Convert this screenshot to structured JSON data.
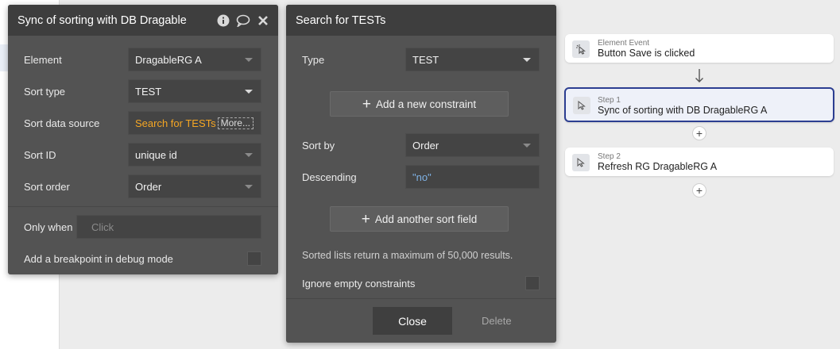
{
  "panel_left": {
    "title": "Sync of sorting with DB Dragable",
    "rows": {
      "element": {
        "label": "Element",
        "value": "DragableRG A"
      },
      "sort_type": {
        "label": "Sort type",
        "value": "TEST"
      },
      "sort_data_source": {
        "label": "Sort data source",
        "value": "Search for TESTs",
        "more": "More..."
      },
      "sort_id": {
        "label": "Sort ID",
        "value": "unique id"
      },
      "sort_order": {
        "label": "Sort order",
        "value": "Order"
      }
    },
    "only_when": {
      "label": "Only when",
      "placeholder": "Click"
    },
    "breakpoint": {
      "label": "Add a breakpoint in debug mode"
    }
  },
  "panel_search": {
    "title": "Search for TESTs",
    "type": {
      "label": "Type",
      "value": "TEST"
    },
    "add_constraint": "Add a new constraint",
    "sort_by": {
      "label": "Sort by",
      "value": "Order"
    },
    "descending": {
      "label": "Descending",
      "value": "\"no\""
    },
    "add_sort_field": "Add another sort field",
    "note": "Sorted lists return a maximum of 50,000 results.",
    "ignore_empty": {
      "label": "Ignore empty constraints"
    },
    "close_label": "Close",
    "delete_label": "Delete"
  },
  "workflow": {
    "event": {
      "small": "Element Event",
      "big": "Button Save is clicked"
    },
    "step1": {
      "small": "Step 1",
      "big": "Sync of sorting with DB DragableRG A"
    },
    "step2": {
      "small": "Step 2",
      "big": "Refresh RG DragableRG A"
    }
  },
  "colors": {
    "panel_bg": "#535353",
    "header_bg": "#3e3e3e",
    "dynamic_text": "#f5a623",
    "active_border": "#2c3e91"
  },
  "icons": {
    "info": "info-icon",
    "comment": "comment-icon",
    "close": "close-icon",
    "event": "pointer-sparkle-icon",
    "action": "cursor-icon"
  }
}
